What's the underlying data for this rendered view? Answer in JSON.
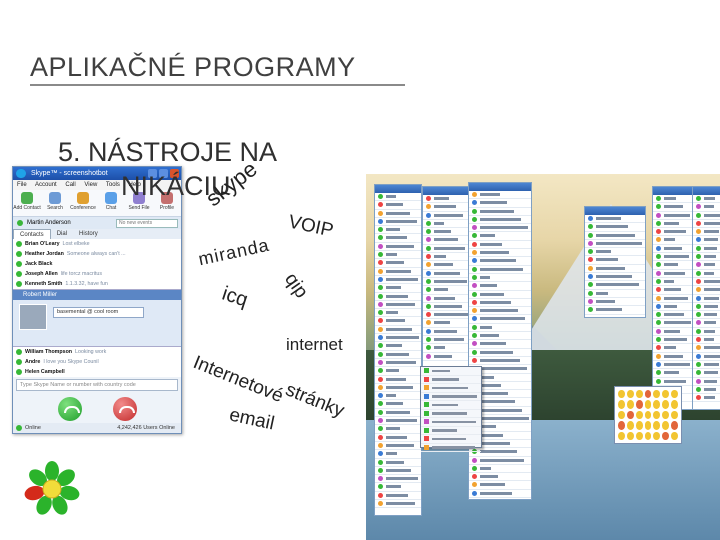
{
  "slide": {
    "title": "APLIKAČNÉ PROGRAMY",
    "subtitle_line1": "5. NÁSTROJE NA",
    "subtitle_line2": "NIKÁCIU"
  },
  "word_cloud": [
    {
      "id": "skype",
      "text": "skype"
    },
    {
      "id": "voip",
      "text": "VOIP"
    },
    {
      "id": "miranda",
      "text": "miranda"
    },
    {
      "id": "qip",
      "text": "qip"
    },
    {
      "id": "icq",
      "text": "icq"
    },
    {
      "id": "internet",
      "text": "internet"
    },
    {
      "id": "internetove",
      "text": "Internetové"
    },
    {
      "id": "stranky",
      "text": "stránky"
    },
    {
      "id": "email",
      "text": "email"
    }
  ],
  "skype_window": {
    "title": "Skype™ - screenshotbot",
    "menu": [
      "File",
      "Account",
      "Call",
      "View",
      "Tools",
      "Help"
    ],
    "toolbar": [
      "Add Contact",
      "Search",
      "Conference",
      "Chat",
      "Send File",
      "Profile"
    ],
    "user": "Martin Anderson",
    "status_placeholder": "No new events",
    "tabs": [
      "Contacts",
      "Dial",
      "History"
    ],
    "contacts": [
      {
        "name": "Brian O'Leary",
        "mood": "Lost elbeke"
      },
      {
        "name": "Heather Jordan",
        "mood": "Someone always can't ..."
      },
      {
        "name": "Jack Black",
        "mood": ""
      },
      {
        "name": "Joseph Allen",
        "mood": "life torcz macritus"
      },
      {
        "name": "Kenneth Smith",
        "mood": "1.1.3.32, have fun"
      }
    ],
    "selected_contact": {
      "name": "Robert Miller",
      "message": "basemental @ cool room"
    },
    "more_contacts": [
      {
        "name": "William Thompson",
        "mood": "Looking work"
      },
      {
        "name": "Andre",
        "mood": "I love you Skype Counil"
      },
      {
        "name": "Helen Campbell",
        "mood": ""
      }
    ],
    "dial_placeholder": "Type Skype Name or number with country code",
    "footer_status": "Online",
    "users_online": "4,242,426 Users Online"
  },
  "colors": {
    "title_rule": "#8a8a8a",
    "skype_blue": "#2f6fd0",
    "call_green": "#1f9e2a",
    "hangup_red": "#c22a2a",
    "icq_green": "#2bb32b",
    "icq_red": "#d42a1a"
  },
  "icons": {
    "call": "phone-call-icon",
    "hangup": "phone-hangup-icon",
    "icq_logo": "icq-flower-logo",
    "skype_logo": "skype-logo-icon"
  }
}
